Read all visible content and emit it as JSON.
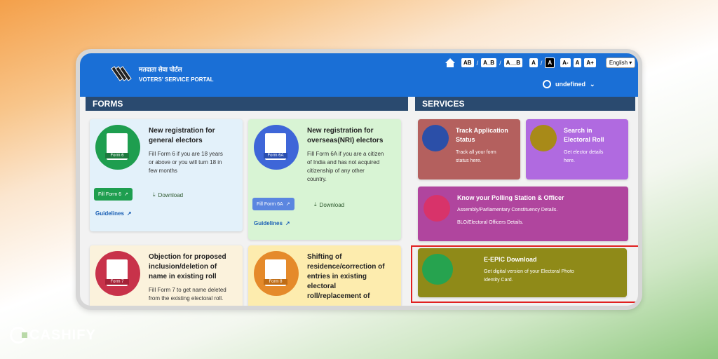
{
  "topbar": {
    "portal_hindi": "मतदाता सेवा पोर्टल",
    "portal_english": "VOTERS' SERVICE PORTAL",
    "accessibility": [
      "AB",
      "A_B",
      "A__B",
      "A",
      "A",
      "A-",
      "A",
      "A+"
    ],
    "language": "English",
    "user_name": "undefined"
  },
  "forms": {
    "section_title": "FORMS",
    "cards": [
      {
        "tag": "Form 6",
        "title_l1": "New registration for",
        "title_l2": "general electors",
        "desc": [
          "Fill Form 6 if you are 18 years",
          "or above or you will turn 18 in",
          "few months"
        ],
        "fill_label": "Fill Form 6",
        "download_label": "Download",
        "guidelines_label": "Guidelines"
      },
      {
        "tag": "Form 6A",
        "title_l1": "New registration for",
        "title_l2": "overseas(NRI) electors",
        "desc": [
          "Fill Form 6A if you are a citizen",
          "of India and has not acquired",
          "citizenship of any other",
          "country."
        ],
        "fill_label": "Fill Form 6A",
        "download_label": "Download",
        "guidelines_label": "Guidelines"
      },
      {
        "tag": "Form 7",
        "title_l1": "Objection for proposed",
        "title_l2": "inclusion/deletion of",
        "title_l3": "name in existing roll",
        "desc": [
          "Fill Form 7 to get name deleted",
          "from the existing electoral roll."
        ]
      },
      {
        "tag": "Form 8",
        "title_l1": "Shifting of",
        "title_l2": "residence/correction of",
        "title_l3": "entries in existing",
        "title_l4": "electoral",
        "title_l5": "roll/replacement of"
      }
    ]
  },
  "services": {
    "section_title": "SERVICES",
    "items": [
      {
        "title_l1": "Track Application",
        "title_l2": "Status",
        "desc_l1": "Track all your form",
        "desc_l2": "status here."
      },
      {
        "title_l1": "Search in",
        "title_l2": "Electoral Roll",
        "desc_l1": "Get elector details",
        "desc_l2": "here."
      },
      {
        "title_l1": "Know your Polling Station & Officer",
        "desc_l1": "Assembly/Parliamentary Constituency Details.",
        "desc_l2": "BLO/Electoral Officers Details."
      },
      {
        "title_l1": "E-EPIC Download",
        "desc_l1": "Get digital version of your Electoral Photo",
        "desc_l2": "Identity Card."
      }
    ]
  },
  "brand": "CASHIFY"
}
